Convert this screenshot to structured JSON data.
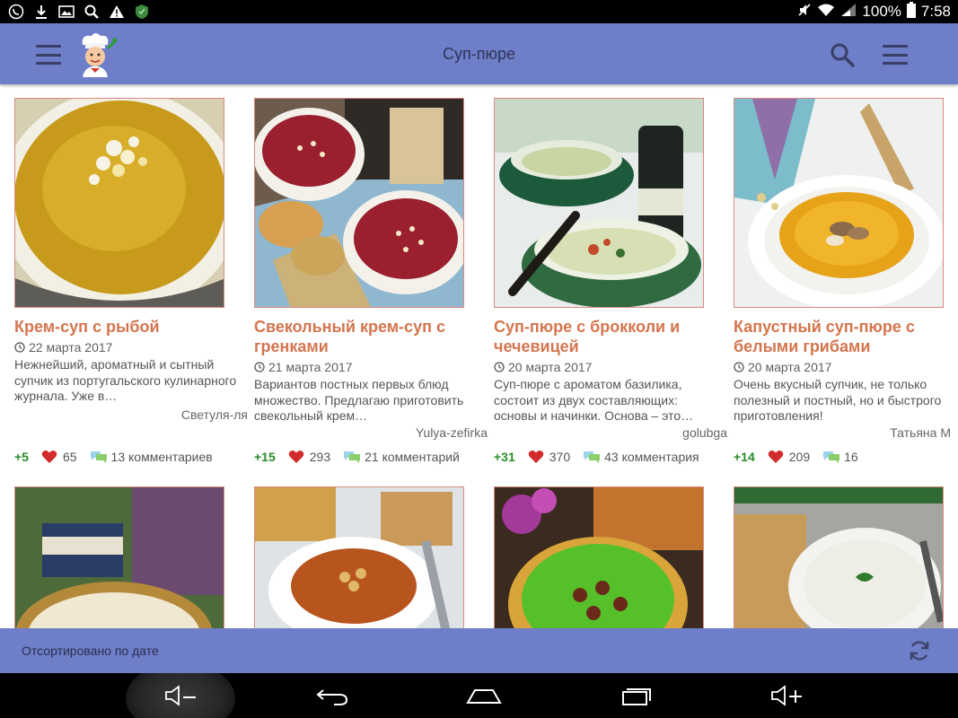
{
  "status_bar": {
    "battery": "100%",
    "time": "7:58",
    "left_icons": [
      "viber-icon",
      "download-icon",
      "image-icon",
      "search-icon",
      "warning-icon",
      "shield-icon"
    ],
    "right_icons": [
      "mute-icon",
      "wifi-icon",
      "signal-icon",
      "battery-icon"
    ]
  },
  "app_bar": {
    "title": "Суп-пюре"
  },
  "recipes": [
    {
      "title": "Крем-суп с рыбой",
      "date": "22 марта 2017",
      "description": "Нежнейший, ароматный и сытный супчик из португальского кулинарного журнала. Уже в…",
      "author": "Светуля-ля",
      "rating": "+5",
      "likes": "65",
      "comments": "13 комментариев"
    },
    {
      "title": "Свекольный крем-суп с гренками",
      "date": "21 марта 2017",
      "description": "Вариантов постных первых блюд множество. Предлагаю приготовить свекольный крем…",
      "author": "Yulya-zefirka",
      "rating": "+15",
      "likes": "293",
      "comments": "21 комментарий"
    },
    {
      "title": "Суп-пюре с брокколи и чечевицей",
      "date": "20 марта 2017",
      "description": "Суп-пюре с ароматом базилика, состоит из двух составляющих: основы и начинки. Основа – это…",
      "author": "golubga",
      "rating": "+31",
      "likes": "370",
      "comments": "43 комментария"
    },
    {
      "title": "Капустный суп-пюре с белыми грибами",
      "date": "20 марта 2017",
      "description": "Очень вкусный супчик, не только полезный и постный, но и быстрого приготовления!",
      "author": "Татьяна М",
      "rating": "+14",
      "likes": "209",
      "comments": "16"
    }
  ],
  "sort_bar": {
    "label": "Отсортировано по дате"
  },
  "colors": {
    "app_bar": "#6e7ec8",
    "title_accent": "#d4754e",
    "rating_green": "#2a8c2a",
    "heart_red": "#d22b2b"
  }
}
